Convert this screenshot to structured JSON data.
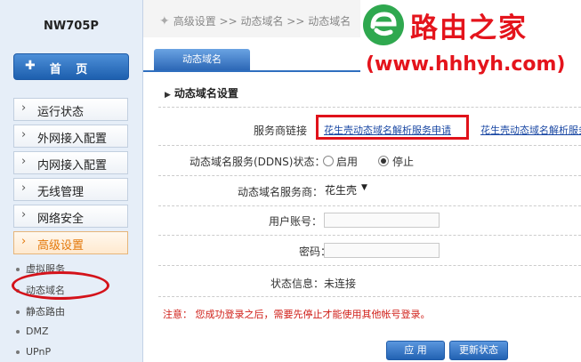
{
  "sidebar": {
    "model": "NW705P",
    "home": "首 页",
    "menu": [
      {
        "label": "运行状态"
      },
      {
        "label": "外网接入配置"
      },
      {
        "label": "内网接入配置"
      },
      {
        "label": "无线管理"
      },
      {
        "label": "网络安全"
      },
      {
        "label": "高级设置"
      }
    ],
    "submenu": [
      {
        "label": "虚拟服务"
      },
      {
        "label": "动态域名"
      },
      {
        "label": "静态路由"
      },
      {
        "label": "DMZ"
      },
      {
        "label": "UPnP"
      }
    ]
  },
  "breadcrumb": {
    "text": "高级设置 >> 动态域名 >> 动态域名"
  },
  "tab": {
    "label": "动态域名"
  },
  "section": {
    "title": "动态域名设置"
  },
  "form": {
    "provider_link_label": "服务商链接",
    "provider_link_1": "花生壳动态域名解析服务申请",
    "provider_link_2": "花生壳动态域名解析服务",
    "ddns_label": "动态域名服务(DDNS)状态：",
    "ddns_enable": "启用",
    "ddns_stop": "停止",
    "ddns_value": "停止",
    "isp_label": "动态域名服务商：",
    "isp_value": "花生壳",
    "account_label": "用户账号：",
    "account_value": "",
    "password_label": "密码：",
    "password_value": "",
    "status_label": "状态信息：",
    "status_value": "未连接"
  },
  "notice": "注意： 您成功登录之后，需要先停止才能使用其他帐号登录。",
  "buttons": {
    "apply": "应 用",
    "refresh": "更新状态"
  },
  "watermark": {
    "title": "路由之家",
    "url": "(www.hhhyh.com)"
  },
  "colors": {
    "accent": "#2f6fbf",
    "highlight": "#e3780a",
    "annotation": "#e0121a"
  }
}
